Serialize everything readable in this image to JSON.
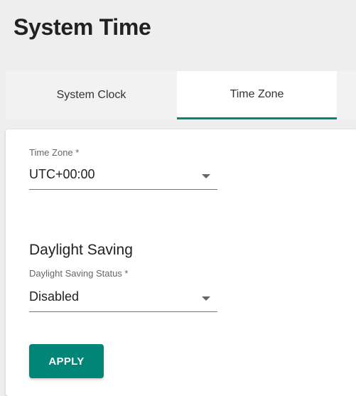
{
  "page": {
    "title": "System Time"
  },
  "tabs": [
    {
      "label": "System Clock",
      "active": false
    },
    {
      "label": "Time Zone",
      "active": true
    }
  ],
  "time_zone": {
    "label": "Time Zone *",
    "value": "UTC+00:00"
  },
  "daylight_saving": {
    "section_title": "Daylight Saving",
    "status_label": "Daylight Saving Status *",
    "status_value": "Disabled"
  },
  "actions": {
    "apply_label": "APPLY"
  },
  "colors": {
    "accent": "#008577",
    "tab_indicator": "#00897b",
    "background": "#eeeeee"
  },
  "icons": {
    "dropdown": "chevron-down-icon"
  }
}
